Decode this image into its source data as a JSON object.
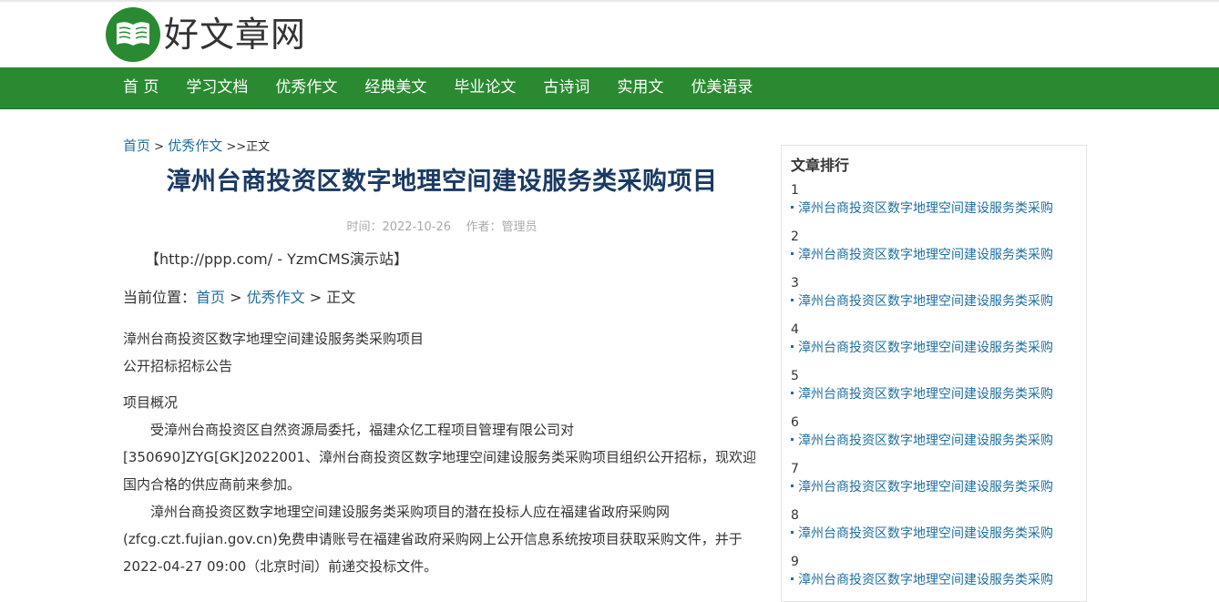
{
  "header": {
    "logo_text": "好文章网"
  },
  "nav": {
    "items": [
      "首 页",
      "学习文档",
      "优秀作文",
      "经典美文",
      "毕业论文",
      "古诗词",
      "实用文",
      "优美语录"
    ]
  },
  "breadcrumb": {
    "home": "首页",
    "sep1": " > ",
    "category": "优秀作文",
    "sep2": " >>",
    "current": "正文"
  },
  "article": {
    "title": "漳州台商投资区数字地理空间建设服务类采购项目",
    "meta": "时间：2022-10-26    作者：管理员",
    "site_line": "【http://ppp.com/ - YzmCMS演示站】",
    "position": {
      "label": "当前位置：",
      "home": "首页",
      "sep1": " > ",
      "category": "优秀作文",
      "sep2": " > ",
      "current": "正文"
    },
    "line1": "漳州台商投资区数字地理空间建设服务类采购项目",
    "line2": "公开招标招标公告",
    "overview_title": "项目概况",
    "paragraph1": "　　受漳州台商投资区自然资源局委托，福建众亿工程项目管理有限公司对[350690]ZYG[GK]2022001、漳州台商投资区数字地理空间建设服务类采购项目组织公开招标，现欢迎国内合格的供应商前来参加。",
    "paragraph2": "　　漳州台商投资区数字地理空间建设服务类采购项目的潜在投标人应在福建省政府采购网(zfcg.czt.fujian.gov.cn)免费申请账号在福建省政府采购网上公开信息系统按项目获取采购文件，并于2022-04-27 09:00（北京时间）前递交投标文件。"
  },
  "sidebar": {
    "title": "文章排行",
    "items": [
      {
        "num": "1",
        "text": "漳州台商投资区数字地理空间建设服务类采购"
      },
      {
        "num": "2",
        "text": "漳州台商投资区数字地理空间建设服务类采购"
      },
      {
        "num": "3",
        "text": "漳州台商投资区数字地理空间建设服务类采购"
      },
      {
        "num": "4",
        "text": "漳州台商投资区数字地理空间建设服务类采购"
      },
      {
        "num": "5",
        "text": "漳州台商投资区数字地理空间建设服务类采购"
      },
      {
        "num": "6",
        "text": "漳州台商投资区数字地理空间建设服务类采购"
      },
      {
        "num": "7",
        "text": "漳州台商投资区数字地理空间建设服务类采购"
      },
      {
        "num": "8",
        "text": "漳州台商投资区数字地理空间建设服务类采购"
      },
      {
        "num": "9",
        "text": "漳州台商投资区数字地理空间建设服务类采购"
      }
    ]
  },
  "colors": {
    "brand_green": "#2a8a31",
    "link_blue": "#1f6f9e",
    "title_navy": "#1a3a63"
  },
  "icons": {
    "logo": "open-book-icon"
  }
}
